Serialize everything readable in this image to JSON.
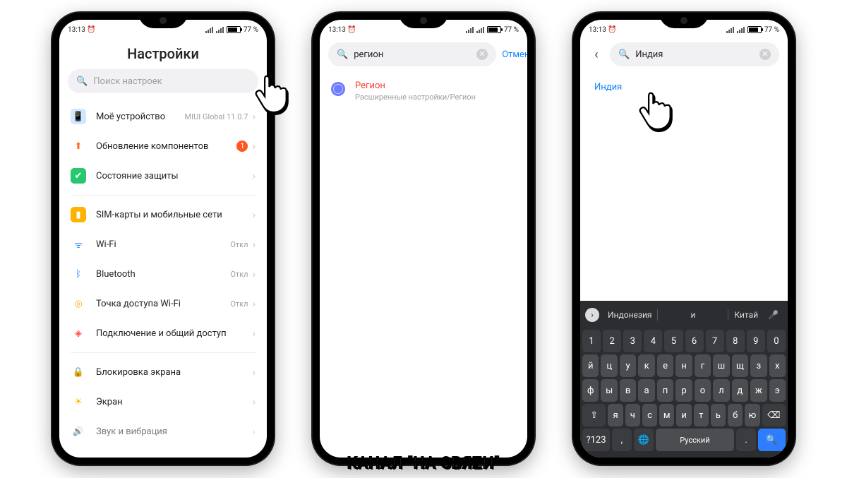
{
  "status": {
    "time": "13:13",
    "battery_pct": "77"
  },
  "phone1": {
    "title": "Настройки",
    "search_placeholder": "Поиск настроек",
    "items": [
      {
        "label": "Моё устройство",
        "sub": "MIUI Global 11.0.7",
        "icon": "device",
        "color": "#e3f1ff"
      },
      {
        "label": "Обновление компонентов",
        "badge": "1",
        "icon": "update",
        "color": "#ff7a2e"
      },
      {
        "label": "Состояние защиты",
        "icon": "shield",
        "color": "#29c76f"
      }
    ],
    "items2": [
      {
        "label": "SIM-карты и мобильные сети",
        "icon": "sim",
        "color": "#ffb300"
      },
      {
        "label": "Wi-Fi",
        "sub": "Откл",
        "icon": "wifi",
        "color": "#1e88ff"
      },
      {
        "label": "Bluetooth",
        "sub": "Откл",
        "icon": "bt",
        "color": "#1e88ff"
      },
      {
        "label": "Точка доступа Wi-Fi",
        "sub": "Откл",
        "icon": "hotspot",
        "color": "#ff9f1e"
      },
      {
        "label": "Подключение и общий доступ",
        "icon": "share",
        "color": "#ff4d4d"
      }
    ],
    "items3": [
      {
        "label": "Блокировка экрана",
        "icon": "lock",
        "color": "#ff5a5a"
      },
      {
        "label": "Экран",
        "icon": "display",
        "color": "#ffb300"
      },
      {
        "label": "Звук и вибрация",
        "icon": "sound",
        "color": "#29c76f"
      }
    ]
  },
  "phone2": {
    "search_value": "регион",
    "cancel": "Отмена",
    "result_title": "Регион",
    "result_path": "Расширенные настройки/Регион"
  },
  "phone3": {
    "search_value": "Индия",
    "hit": "Индия",
    "suggestions": {
      "s1": "Индонезия",
      "s2": "и",
      "s3": "Китай"
    },
    "rows": {
      "r1": [
        "1",
        "2",
        "3",
        "4",
        "5",
        "6",
        "7",
        "8",
        "9",
        "0"
      ],
      "r2": [
        "й",
        "ц",
        "у",
        "к",
        "е",
        "н",
        "г",
        "ш",
        "щ",
        "з",
        "х"
      ],
      "r3": [
        "ф",
        "ы",
        "в",
        "а",
        "п",
        "р",
        "о",
        "л",
        "д",
        "ж",
        "э"
      ],
      "r4": [
        "я",
        "ч",
        "с",
        "м",
        "и",
        "т",
        "ь",
        "б",
        "ю"
      ],
      "space": "Русский",
      "sym": "?123"
    }
  },
  "watermark": {
    "a": "КАНАЛ \"НА СВЯ",
    "z": "Z",
    "b": "И\""
  }
}
